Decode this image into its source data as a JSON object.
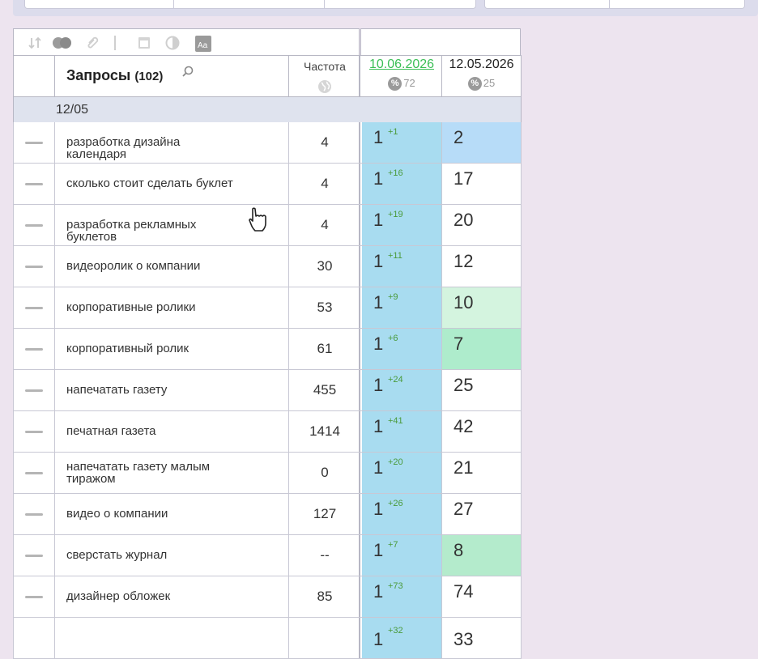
{
  "toolbar": {
    "icons": [
      "sort-icon",
      "circles-icon",
      "attach-icon",
      "divider",
      "window-icon",
      "contrast-icon",
      "font-size-icon"
    ]
  },
  "header": {
    "queries_label": "Запросы",
    "queries_count": "(102)",
    "frequency_label": "Частота",
    "date1": "10.06.2026",
    "date1_pct": "72",
    "date2": "12.05.2026",
    "date2_pct": "25",
    "pct_symbol": "%"
  },
  "group_label": "12/05",
  "rows": [
    {
      "query": "разработка дизайна календаря",
      "freq": "4",
      "pos1": "1",
      "delta1": "+1",
      "pos2": "2",
      "pos2_color": "#b7dcf8"
    },
    {
      "query": "сколько стоит сделать буклет",
      "freq": "4",
      "pos1": "1",
      "delta1": "+16",
      "pos2": "17",
      "pos2_color": "#ffffff"
    },
    {
      "query": "разработка рекламных буклетов",
      "freq": "4",
      "pos1": "1",
      "delta1": "+19",
      "pos2": "20",
      "pos2_color": "#ffffff"
    },
    {
      "query": "видеоролик о компании",
      "freq": "30",
      "pos1": "1",
      "delta1": "+11",
      "pos2": "12",
      "pos2_color": "#ffffff"
    },
    {
      "query": "корпоративные ролики",
      "freq": "53",
      "pos1": "1",
      "delta1": "+9",
      "pos2": "10",
      "pos2_color": "#d4f4df"
    },
    {
      "query": "корпоративный ролик",
      "freq": "61",
      "pos1": "1",
      "delta1": "+6",
      "pos2": "7",
      "pos2_color": "#aeeccc"
    },
    {
      "query": "напечатать газету",
      "freq": "455",
      "pos1": "1",
      "delta1": "+24",
      "pos2": "25",
      "pos2_color": "#ffffff"
    },
    {
      "query": "печатная газета",
      "freq": "1414",
      "pos1": "1",
      "delta1": "+41",
      "pos2": "42",
      "pos2_color": "#ffffff"
    },
    {
      "query": "напечатать газету малым тиражом",
      "freq": "0",
      "pos1": "1",
      "delta1": "+20",
      "pos2": "21",
      "pos2_color": "#ffffff"
    },
    {
      "query": "видео о компании",
      "freq": "127",
      "pos1": "1",
      "delta1": "+26",
      "pos2": "27",
      "pos2_color": "#ffffff"
    },
    {
      "query": "сверстать журнал",
      "freq": "--",
      "pos1": "1",
      "delta1": "+7",
      "pos2": "8",
      "pos2_color": "#b4ebcc"
    },
    {
      "query": "дизайнер обложек",
      "freq": "85",
      "pos1": "1",
      "delta1": "+73",
      "pos2": "74",
      "pos2_color": "#ffffff"
    },
    {
      "query": "",
      "freq": "",
      "pos1": "1",
      "delta1": "+32",
      "pos2": "33",
      "pos2_color": "#ffffff"
    }
  ],
  "colors": {
    "page_bg": "#ede4ef",
    "pos1_bg": "#a8dcf0",
    "date1_color": "#3bbf56",
    "delta_color": "#4a9a3a"
  }
}
